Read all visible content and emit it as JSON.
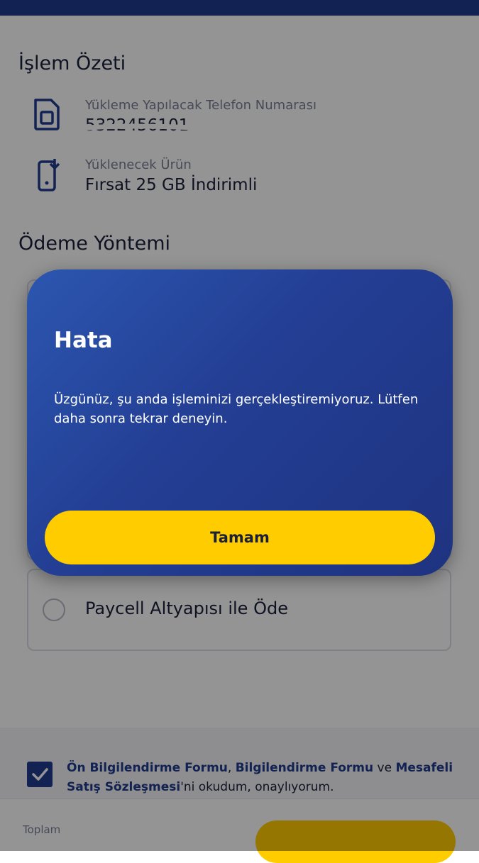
{
  "summary": {
    "title": "İşlem Özeti",
    "phone_label": "Yükleme Yapılacak Telefon Numarası",
    "phone_value": "5322456101",
    "product_label": "Yüklenecek Ürün",
    "product_value": "Fırsat 25 GB İndirimli"
  },
  "payment": {
    "title": "Ödeme Yöntemi",
    "option_paycell": "Paycell Altyapısı ile Öde"
  },
  "consent": {
    "checked": true,
    "link1": "Ön Bilgilendirme Formu",
    "sep1": ", ",
    "link2": "Bilgilendirme Formu",
    "sep2": " ve ",
    "link3": "Mesafeli Satış Sözleşmesi",
    "tail": "'ni okudum, onaylıyorum."
  },
  "footer": {
    "total_label": "Toplam"
  },
  "modal": {
    "title": "Hata",
    "message": "Üzgünüz, şu anda işleminizi gerçekleştiremiyoruz. Lütfen daha sonra tekrar deneyin.",
    "ok_label": "Tamam"
  },
  "colors": {
    "brand_blue": "#1e3b8f",
    "accent_yellow": "#ffcc00"
  },
  "icons": {
    "sim": "sim-card-icon",
    "download_phone": "phone-download-icon",
    "check": "checkmark-icon"
  }
}
